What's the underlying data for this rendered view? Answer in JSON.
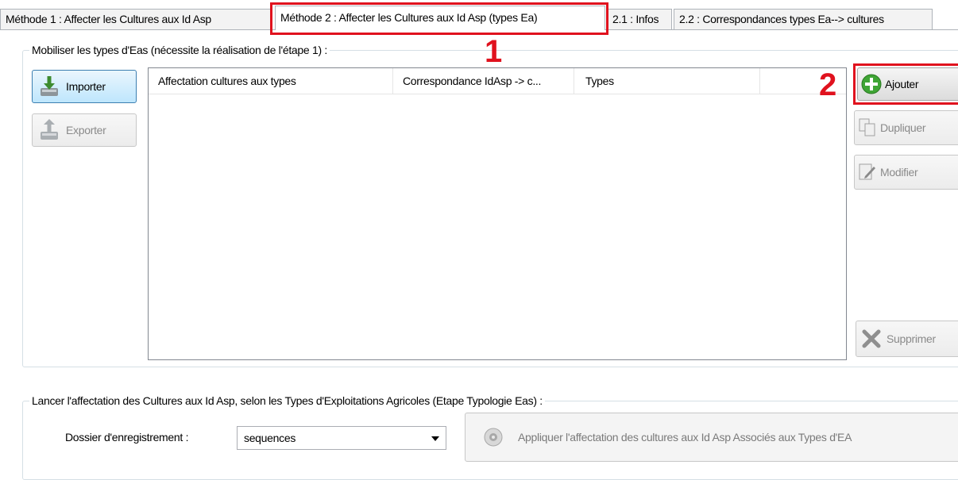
{
  "tabs": [
    {
      "label": "Méthode 1 : Affecter les Cultures aux Id Asp"
    },
    {
      "label": "Méthode 2 : Affecter les Cultures aux Id Asp (types Ea)"
    },
    {
      "label": "2.1 : Infos"
    },
    {
      "label": "2.2 : Correspondances types Ea--> cultures"
    }
  ],
  "annotations": {
    "marker1": "1",
    "marker2": "2",
    "color": "#e0121e"
  },
  "group_types": {
    "title": "Mobiliser les types d'Eas (nécessite la réalisation de l'étape 1) :",
    "import_label": "Importer",
    "export_label": "Exporter",
    "columns": [
      "Affectation cultures aux types",
      "Correspondance IdAsp -> c...",
      "Types"
    ],
    "add_label": "Ajouter",
    "duplicate_label": "Dupliquer",
    "modify_label": "Modifier",
    "delete_label": "Supprimer"
  },
  "group_launch": {
    "title": "Lancer l'affectation des Cultures aux Id Asp, selon les Types d'Exploitations Agricoles (Etape Typologie Eas) :",
    "folder_label": "Dossier d'enregistrement :",
    "folder_value": "sequences",
    "apply_label": "Appliquer l'affectation des cultures aux Id Asp Associés aux Types d'EA"
  },
  "icons": {
    "import": "import-arrow-icon",
    "export": "export-icon",
    "add": "plus-circle-icon",
    "duplicate": "duplicate-icon",
    "modify": "edit-icon",
    "delete": "delete-x-icon",
    "apply": "apply-gear-icon"
  }
}
